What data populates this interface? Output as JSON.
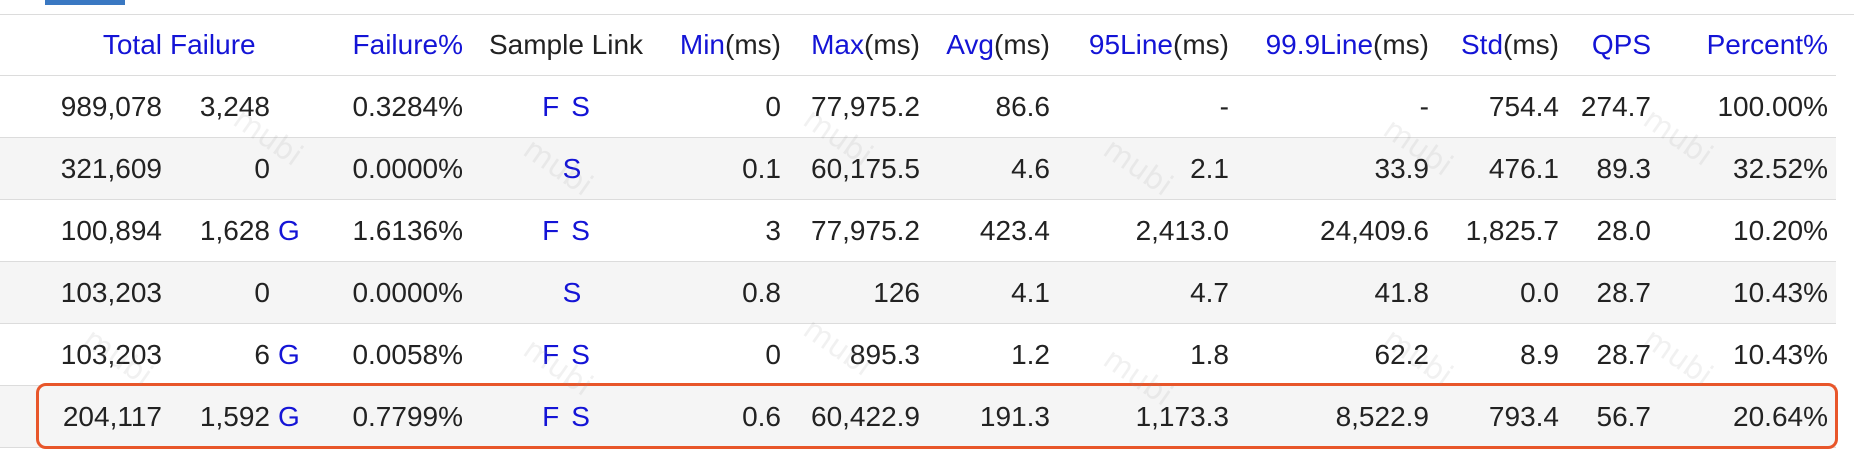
{
  "columns": [
    {
      "label": "Total",
      "suffix": ""
    },
    {
      "label": "Failure",
      "suffix": ""
    },
    {
      "label": "",
      "suffix": ""
    },
    {
      "label": "Failure%",
      "suffix": ""
    },
    {
      "label": "Sample Link",
      "suffix": ""
    },
    {
      "label": "Min",
      "suffix": "(ms)"
    },
    {
      "label": "Max",
      "suffix": "(ms)"
    },
    {
      "label": "Avg",
      "suffix": "(ms)"
    },
    {
      "label": "95Line",
      "suffix": "(ms)"
    },
    {
      "label": "99.9Line",
      "suffix": "(ms)"
    },
    {
      "label": "Std",
      "suffix": "(ms)"
    },
    {
      "label": "QPS",
      "suffix": ""
    },
    {
      "label": "Percent%",
      "suffix": ""
    }
  ],
  "rows": [
    {
      "total": "989,078",
      "failure": "3,248",
      "g": "",
      "failure_pct": "0.3284%",
      "f": "F",
      "s": "S",
      "min": "0",
      "max": "77,975.2",
      "avg": "86.6",
      "line95": "-",
      "line999": "-",
      "std": "754.4",
      "qps": "274.7",
      "percent": "100.00%"
    },
    {
      "total": "321,609",
      "failure": "0",
      "g": "",
      "failure_pct": "0.0000%",
      "f": "",
      "s": "S",
      "min": "0.1",
      "max": "60,175.5",
      "avg": "4.6",
      "line95": "2.1",
      "line999": "33.9",
      "std": "476.1",
      "qps": "89.3",
      "percent": "32.52%"
    },
    {
      "total": "100,894",
      "failure": "1,628",
      "g": "G",
      "failure_pct": "1.6136%",
      "f": "F",
      "s": "S",
      "min": "3",
      "max": "77,975.2",
      "avg": "423.4",
      "line95": "2,413.0",
      "line999": "24,409.6",
      "std": "1,825.7",
      "qps": "28.0",
      "percent": "10.20%"
    },
    {
      "total": "103,203",
      "failure": "0",
      "g": "",
      "failure_pct": "0.0000%",
      "f": "",
      "s": "S",
      "min": "0.8",
      "max": "126",
      "avg": "4.1",
      "line95": "4.7",
      "line999": "41.8",
      "std": "0.0",
      "qps": "28.7",
      "percent": "10.43%"
    },
    {
      "total": "103,203",
      "failure": "6",
      "g": "G",
      "failure_pct": "0.0058%",
      "f": "F",
      "s": "S",
      "min": "0",
      "max": "895.3",
      "avg": "1.2",
      "line95": "1.8",
      "line999": "62.2",
      "std": "8.9",
      "qps": "28.7",
      "percent": "10.43%"
    },
    {
      "total": "204,117",
      "failure": "1,592",
      "g": "G",
      "failure_pct": "0.7799%",
      "f": "F",
      "s": "S",
      "min": "0.6",
      "max": "60,422.9",
      "avg": "191.3",
      "line95": "1,173.3",
      "line999": "8,522.9",
      "std": "793.4",
      "qps": "56.7",
      "percent": "20.64%"
    }
  ],
  "watermark": "mubi",
  "colors": {
    "link": "#1414d6",
    "highlight": "#e8562a",
    "row_alt": "#f5f5f5",
    "tab": "#3a78c2"
  }
}
